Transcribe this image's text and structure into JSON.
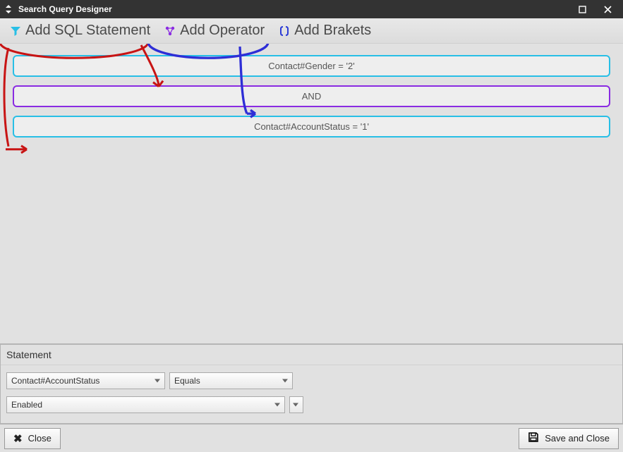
{
  "window": {
    "title": "Search Query Designer"
  },
  "toolbar": {
    "add_sql": "Add SQL Statement",
    "add_operator": "Add Operator",
    "add_brackets": "Add Brakets"
  },
  "colors": {
    "sql_accent": "#28bfe6",
    "op_accent": "#8a2be2",
    "bracket_accent": "#2b3bd6",
    "annotation_red": "#c81414",
    "annotation_blue": "#2e2ed6"
  },
  "query_rows": [
    {
      "type": "sql",
      "text": "Contact#Gender = '2'"
    },
    {
      "type": "op",
      "text": "AND"
    },
    {
      "type": "sql",
      "text": "Contact#AccountStatus = '1'"
    }
  ],
  "statement": {
    "header": "Statement",
    "field": "Contact#AccountStatus",
    "comparator": "Equals",
    "value": "Enabled"
  },
  "footer": {
    "close": "Close",
    "save_close": "Save and Close"
  }
}
